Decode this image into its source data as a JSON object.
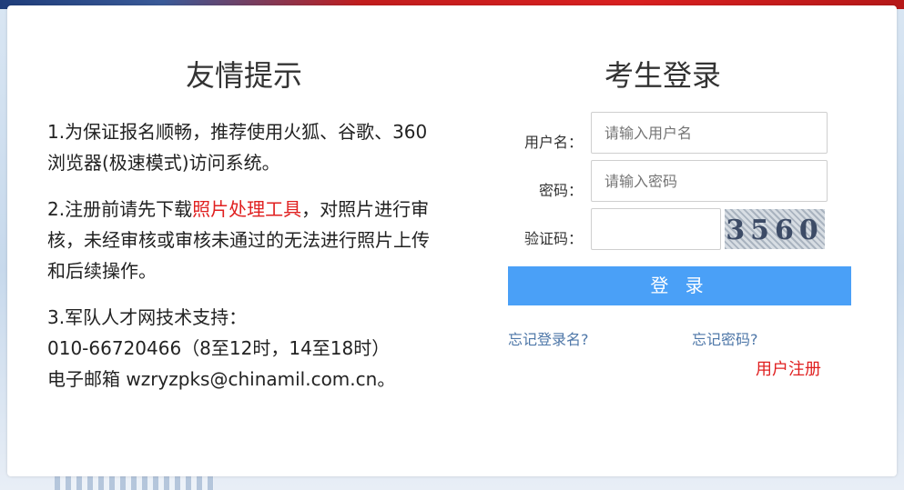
{
  "tips": {
    "title": "友情提示",
    "item1": "1.为保证报名顺畅，推荐使用火狐、谷歌、360浏览器(极速模式)访问系统。",
    "item2_before": "2.注册前请先下载",
    "item2_link": "照片处理工具",
    "item2_after": "，对照片进行审核，未经审核或审核未通过的无法进行照片上传和后续操作。",
    "item3_line1": "3.军队人才网技术支持：",
    "item3_line2": "010-66720466（8至12时，14至18时）",
    "item3_line3": "电子邮箱 wzryzpks@chinamil.com.cn。"
  },
  "login": {
    "title": "考生登录",
    "username_label": "用户名：",
    "username_placeholder": "请输入用户名",
    "password_label": "密码：",
    "password_placeholder": "请输入密码",
    "captcha_label": "验证码：",
    "captcha_value": "",
    "captcha_text": "3560",
    "submit_label": "登 录",
    "forgot_username": "忘记登录名?",
    "forgot_password": "忘记密码?",
    "register": "用户注册"
  },
  "colors": {
    "accent": "#4aa0f7",
    "link_red": "#e02020",
    "link_blue": "#4e77a8"
  }
}
